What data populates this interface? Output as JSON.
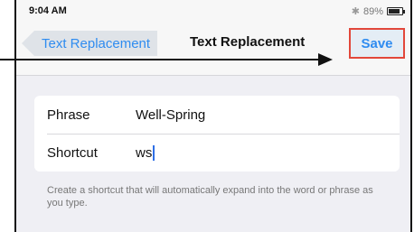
{
  "status_bar": {
    "time": "9:04 AM",
    "battery": "89%",
    "battery_level": 0.89
  },
  "nav": {
    "back_label": "Text Replacement",
    "title": "Text Replacement",
    "save_label": "Save"
  },
  "form": {
    "phrase_label": "Phrase",
    "phrase_value": "Well-Spring",
    "shortcut_label": "Shortcut",
    "shortcut_value": "ws"
  },
  "footer_note": "Create a shortcut that will automatically expand into the word or phrase as you type.",
  "colors": {
    "accent": "#2f8cf0",
    "highlight": "#e2473a",
    "background": "#efeff4"
  },
  "icons": [
    "bluetooth-icon",
    "battery-icon",
    "back-chevron-icon",
    "annotation-arrow"
  ]
}
